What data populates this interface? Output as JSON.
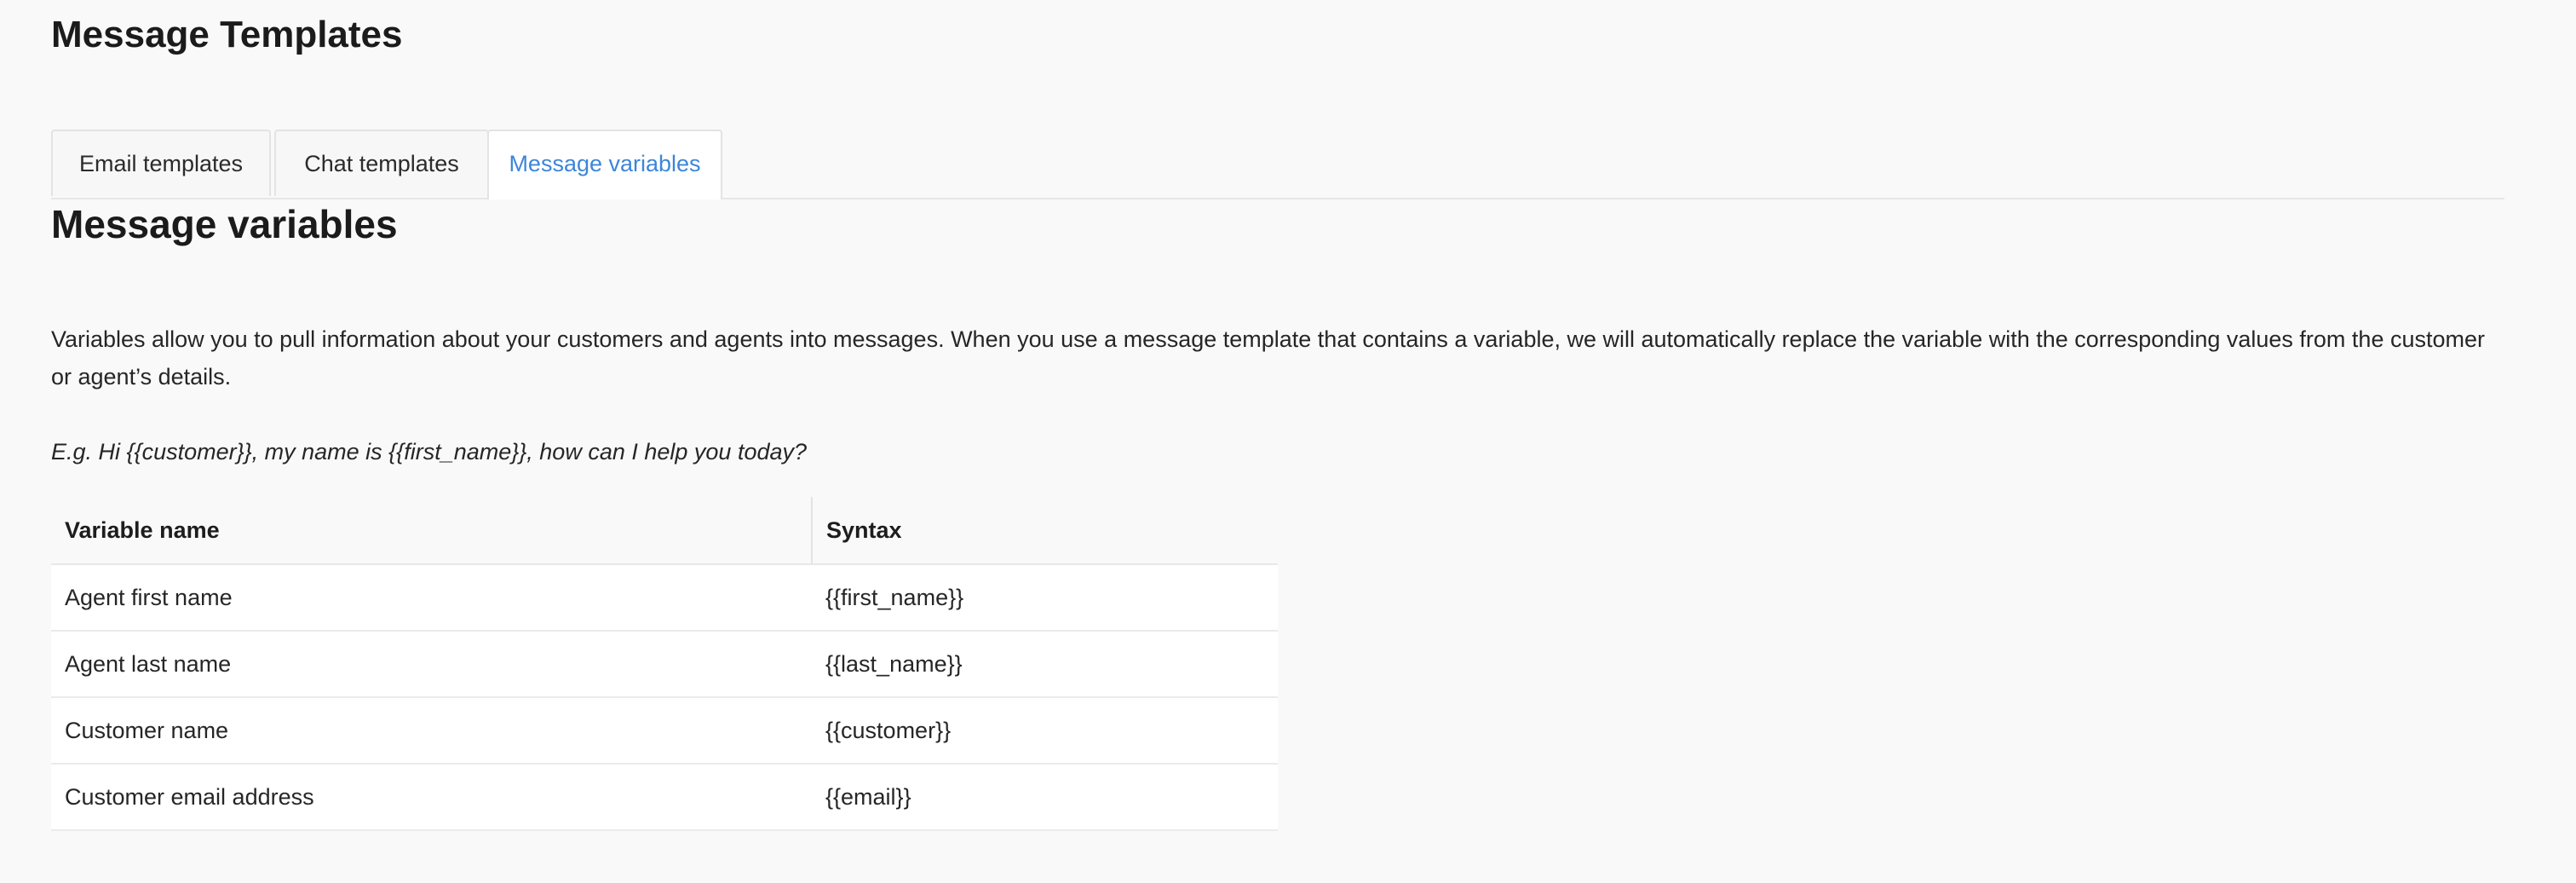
{
  "page": {
    "title": "Message Templates"
  },
  "tabs": [
    {
      "label": "Email templates",
      "active": false
    },
    {
      "label": "Chat templates",
      "active": false
    },
    {
      "label": "Message variables",
      "active": true
    }
  ],
  "section": {
    "title": "Message variables",
    "description": "Variables allow you to pull information about your customers and agents into messages. When you use a message template that contains a variable, we will automatically replace the variable with the corresponding values from the customer or agent’s details.",
    "example": "E.g. Hi {{customer}}, my name is {{first_name}}, how can I help you today?"
  },
  "table": {
    "headers": {
      "name": "Variable name",
      "syntax": "Syntax"
    },
    "rows": [
      {
        "name": "Agent first name",
        "syntax": "{{first_name}}"
      },
      {
        "name": "Agent last name",
        "syntax": "{{last_name}}"
      },
      {
        "name": "Customer name",
        "syntax": "{{customer}}"
      },
      {
        "name": "Customer email address",
        "syntax": "{{email}}"
      }
    ]
  },
  "colors": {
    "background": "#f9f9f9",
    "active_tab_text": "#3d86d8",
    "text": "#1d1d1d"
  }
}
